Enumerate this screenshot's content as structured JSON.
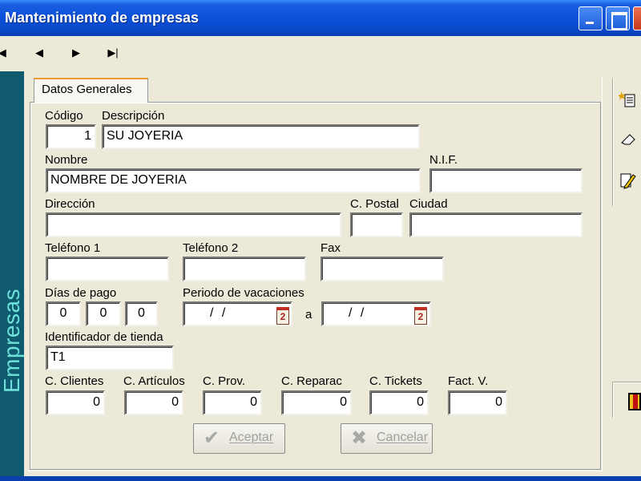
{
  "window": {
    "title": "Mantenimiento de empresas"
  },
  "navigator": [
    "|◀",
    "◀",
    "▶",
    "▶|"
  ],
  "sidebar": {
    "label": "Empresas"
  },
  "tabs": [
    {
      "label": "Datos Generales",
      "active": true
    }
  ],
  "form": {
    "codigo": {
      "label": "Código",
      "value": "1"
    },
    "descripcion": {
      "label": "Descripción",
      "value": "SU JOYERIA"
    },
    "nombre": {
      "label": "Nombre",
      "value": "NOMBRE DE JOYERIA"
    },
    "nif": {
      "label": "N.I.F.",
      "value": ""
    },
    "direccion": {
      "label": "Dirección",
      "value": ""
    },
    "cpostal": {
      "label": "C. Postal",
      "value": ""
    },
    "ciudad": {
      "label": "Ciudad",
      "value": ""
    },
    "telefono1": {
      "label": "Teléfono 1",
      "value": ""
    },
    "telefono2": {
      "label": "Teléfono 2",
      "value": ""
    },
    "fax": {
      "label": "Fax",
      "value": ""
    },
    "dias_pago": {
      "label": "Días de pago",
      "values": [
        "0",
        "0",
        "0"
      ]
    },
    "vacaciones": {
      "label": "Periodo de vacaciones",
      "from": "/ /",
      "separator": "a",
      "to": "/ /",
      "calendar_glyph": "2"
    },
    "identificador": {
      "label": "Identificador de tienda",
      "value": "T1"
    },
    "counters": [
      {
        "label": "C. Clientes",
        "value": "0"
      },
      {
        "label": "C. Artículos",
        "value": "0"
      },
      {
        "label": "C. Prov.",
        "value": "0"
      },
      {
        "label": "C. Reparac",
        "value": "0"
      },
      {
        "label": "C. Tickets",
        "value": "0"
      },
      {
        "label": "Fact. V.",
        "value": "0"
      }
    ]
  },
  "buttons": {
    "aceptar": {
      "label": "Aceptar",
      "enabled": false
    },
    "cancelar": {
      "label": "Cancelar",
      "enabled": false
    }
  },
  "toolbar_icons": [
    "new-record-icon",
    "erase-icon",
    "edit-pencil-icon",
    "exit-door-icon"
  ],
  "colors": {
    "titlebar": "#0a50d8",
    "sidebar": "#0f5a6e",
    "sidebar_text": "#6ce0d8",
    "tab_accent": "#e89c2a"
  }
}
